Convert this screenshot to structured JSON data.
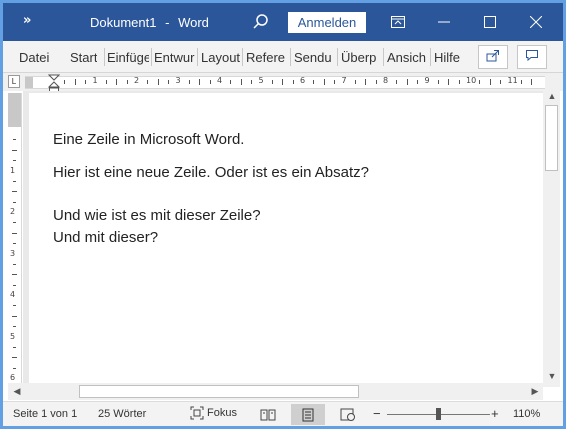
{
  "titlebar": {
    "qat_glyph": "»",
    "doc_name": "Dokument1",
    "separator": "-",
    "app_name": "Word",
    "signin_label": "Anmelden"
  },
  "ribbon": {
    "tabs": [
      "Datei",
      "Start",
      "Einfüge",
      "Entwur",
      "Layout",
      "Refere",
      "Sendu",
      "Überp",
      "Ansich",
      "Hilfe"
    ]
  },
  "hruler": {
    "numbers": [
      "1",
      "2",
      "3",
      "4",
      "5",
      "6",
      "7",
      "8",
      "9",
      "10",
      "11"
    ]
  },
  "vruler": {
    "numbers": [
      "1",
      "2",
      "3",
      "4",
      "5",
      "6"
    ]
  },
  "document": {
    "lines": [
      "Eine Zeile in Microsoft Word.",
      "Hier ist eine neue Zeile. Oder ist es ein Absatz?",
      "Und wie ist es mit dieser Zeile?",
      "Und mit dieser?"
    ]
  },
  "status": {
    "page": "Seite 1 von 1",
    "words": "25 Wörter",
    "focus": "Fokus",
    "zoom_minus": "−",
    "zoom_plus": "+",
    "zoom": "110%"
  },
  "colors": {
    "titlebar": "#2b579a",
    "frame": "#62a0e3"
  }
}
